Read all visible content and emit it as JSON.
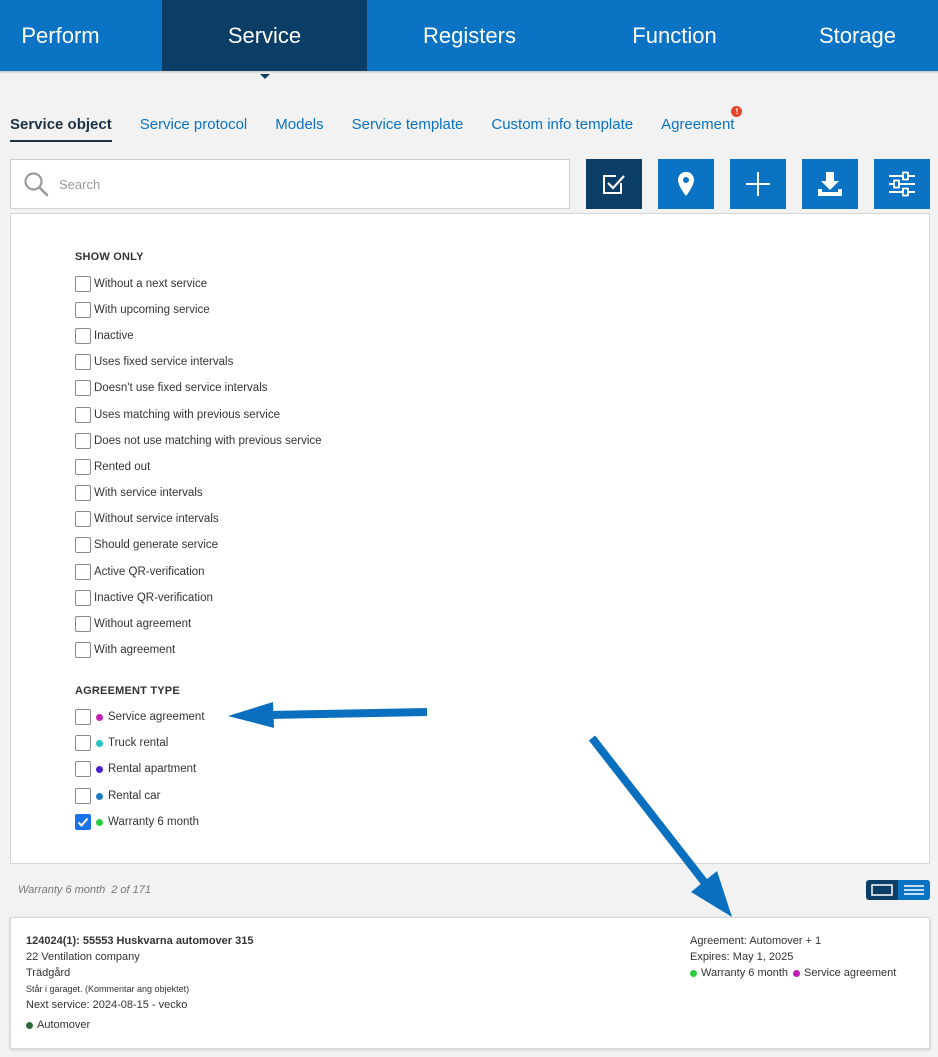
{
  "topnav": {
    "items": [
      {
        "label": "Perform"
      },
      {
        "label": "Service"
      },
      {
        "label": "Registers"
      },
      {
        "label": "Function"
      },
      {
        "label": "Storage"
      }
    ]
  },
  "subtabs": {
    "items": [
      {
        "label": "Service object"
      },
      {
        "label": "Service protocol"
      },
      {
        "label": "Models"
      },
      {
        "label": "Service template"
      },
      {
        "label": "Custom info template"
      },
      {
        "label": "Agreement",
        "alert": "!"
      }
    ]
  },
  "search": {
    "placeholder": "Search",
    "value": ""
  },
  "toolbar": {
    "buttons": [
      "check-square-icon",
      "location-pin-icon",
      "plus-icon",
      "download-icon",
      "sliders-icon"
    ]
  },
  "filters": {
    "show_only_title": "SHOW ONLY",
    "show_only": [
      {
        "label": "Without a next service",
        "checked": false
      },
      {
        "label": "With upcoming service",
        "checked": false
      },
      {
        "label": "Inactive",
        "checked": false
      },
      {
        "label": "Uses fixed service intervals",
        "checked": false
      },
      {
        "label": "Doesn't use fixed service intervals",
        "checked": false
      },
      {
        "label": "Uses matching with previous service",
        "checked": false
      },
      {
        "label": "Does not use matching with previous service",
        "checked": false
      },
      {
        "label": "Rented out",
        "checked": false
      },
      {
        "label": "With service intervals",
        "checked": false
      },
      {
        "label": "Without service intervals",
        "checked": false
      },
      {
        "label": "Should generate service",
        "checked": false
      },
      {
        "label": "Active QR-verification",
        "checked": false
      },
      {
        "label": "Inactive QR-verification",
        "checked": false
      },
      {
        "label": "Without agreement",
        "checked": false
      },
      {
        "label": "With agreement",
        "checked": false
      }
    ],
    "agreement_type_title": "AGREEMENT TYPE",
    "agreement_types": [
      {
        "label": "Service agreement",
        "color": "#c21fb5",
        "checked": false
      },
      {
        "label": "Truck rental",
        "color": "#26c6c0",
        "checked": false
      },
      {
        "label": "Rental apartment",
        "color": "#4b22c9",
        "checked": false
      },
      {
        "label": "Rental car",
        "color": "#1d7bbf",
        "checked": false
      },
      {
        "label": "Warranty 6 month",
        "color": "#2bcc3b",
        "checked": true
      }
    ]
  },
  "results": {
    "filter_label": "Warranty 6 month",
    "count": "2 of 171"
  },
  "card": {
    "title": "124024(1): 55553 Huskvarna automover 315",
    "customer": "22 Ventilation company",
    "category": "Trädgård",
    "comment": "Står i garaget. (Kommentar ang objektet)",
    "next_service": "Next service: 2024-08-15 - vecko",
    "model": "Automover",
    "model_color": "#2f6b3a",
    "agreement": "Agreement: Automover + 1",
    "expires": "Expires: May 1, 2025",
    "tags": [
      {
        "label": "Warranty 6 month",
        "color": "#2bcc3b"
      },
      {
        "label": "Service agreement",
        "color": "#c21fb5"
      }
    ]
  },
  "colors": {
    "primary": "#0a73c4",
    "primary_dark": "#0b3e67",
    "annotation_arrow": "#0b6fbf"
  }
}
